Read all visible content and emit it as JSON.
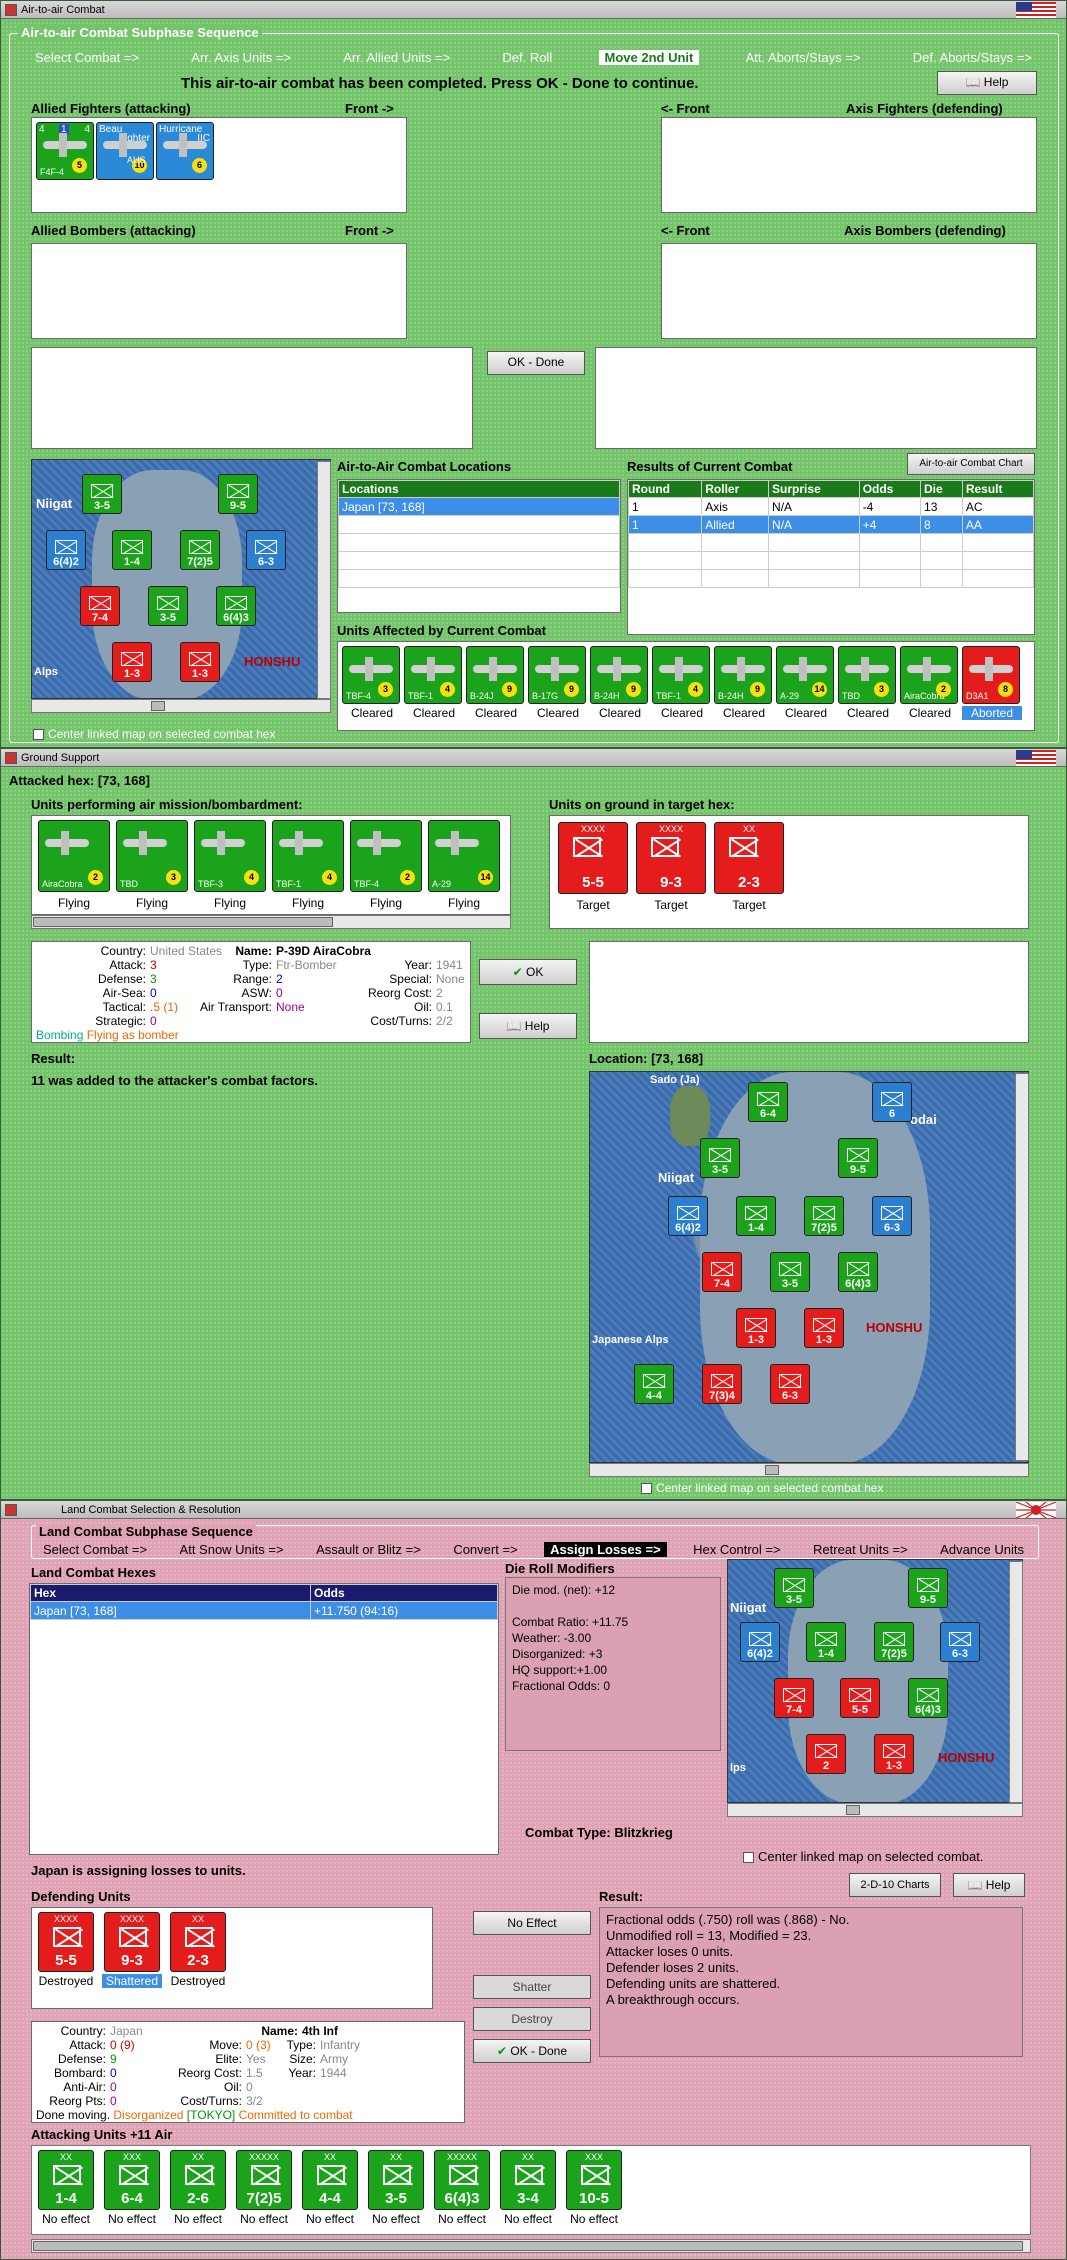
{
  "w1": {
    "title": "Air-to-air Combat",
    "group_title": "Air-to-air Combat Subphase Sequence",
    "steps": [
      "Select Combat =>",
      "Arr. Axis Units =>",
      "Arr. Allied Units =>",
      "Def. Roll",
      "Move 2nd Unit",
      "Att. Aborts/Stays =>",
      "Def. Aborts/Stays =>"
    ],
    "current_step": "Move 2nd Unit",
    "message": "This air-to-air combat has been completed.  Press OK - Done to continue.",
    "help": "Help",
    "allied_fighters": "Allied Fighters (attacking)",
    "front_right": "Front ->",
    "front_left": "<- Front",
    "axis_fighters": "Axis Fighters (defending)",
    "allied_bombers": "Allied Bombers (attacking)",
    "axis_bombers": "Axis Bombers (defending)",
    "ok_done": "OK - Done",
    "fighters": [
      {
        "type": "F4F-4",
        "a": "4",
        "b": "1",
        "c": "4",
        "val": "5"
      },
      {
        "type": "AUS",
        "a": "Beau",
        "b": "fighter",
        "c": "",
        "val": "10"
      },
      {
        "type": "",
        "a": "Hurricane",
        "b": "IIC",
        "c": "",
        "val": "6"
      }
    ],
    "locations_label": "Air-to-Air Combat Locations",
    "locations_header": "Locations",
    "locations": [
      "Japan [73, 168]"
    ],
    "results_label": "Results of Current Combat",
    "chart_btn": "Air-to-air Combat Chart",
    "results_headers": [
      "Round",
      "Roller",
      "Surprise",
      "Odds",
      "Die",
      "Result"
    ],
    "results": [
      [
        "1",
        "Axis",
        "N/A",
        "-4",
        "13",
        "AC"
      ],
      [
        "1",
        "Allied",
        "N/A",
        "+4",
        "8",
        "AA"
      ]
    ],
    "affected_label": "Units Affected by Current Combat",
    "affected": [
      {
        "type": "TBF-4",
        "val": "3",
        "status": "Cleared"
      },
      {
        "type": "TBF-1",
        "val": "4",
        "status": "Cleared"
      },
      {
        "type": "B-24J",
        "val": "9",
        "status": "Cleared"
      },
      {
        "type": "B-17G",
        "val": "9",
        "status": "Cleared"
      },
      {
        "type": "B-24H",
        "val": "9",
        "status": "Cleared"
      },
      {
        "type": "TBF-1",
        "val": "4",
        "status": "Cleared"
      },
      {
        "type": "B-24H",
        "val": "9",
        "status": "Cleared"
      },
      {
        "type": "A-29",
        "val": "14",
        "status": "Cleared"
      },
      {
        "type": "TBD",
        "val": "3",
        "status": "Cleared"
      },
      {
        "type": "AiraCobra",
        "val": "2",
        "status": "Cleared"
      },
      {
        "type": "D3A1",
        "val": "8",
        "status": "Aborted"
      }
    ],
    "map_labels": {
      "a": "Niigat",
      "b": "HONSHU",
      "c": "Alps"
    },
    "center_map": "Center linked map on selected combat hex"
  },
  "w2": {
    "title": "Ground Support",
    "attacked_hex": "Attacked hex:  [73, 168]",
    "units_air_label": "Units performing air mission/bombardment:",
    "units_ground_label": "Units on ground in target hex:",
    "air_units": [
      {
        "type": "AiraCobra",
        "name": "P-39D",
        "val": "2",
        "status": "Flying"
      },
      {
        "type": "TBD",
        "name": "",
        "val": "3",
        "status": "Flying"
      },
      {
        "type": "TBF-3",
        "name": "",
        "val": "4",
        "status": "Flying"
      },
      {
        "type": "TBF-1",
        "name": "",
        "val": "4",
        "status": "Flying"
      },
      {
        "type": "TBF-4",
        "name": "",
        "val": "2",
        "status": "Flying"
      },
      {
        "type": "A-29",
        "name": "Hudson",
        "val": "14",
        "status": "Flying"
      }
    ],
    "ground_units": [
      {
        "str": "5-5",
        "size": "XXXX",
        "status": "Target"
      },
      {
        "str": "9-3",
        "size": "XXXX",
        "status": "Target"
      },
      {
        "str": "2-3",
        "size": "XX",
        "status": "Target"
      }
    ],
    "info": {
      "country_l": "Country:",
      "country": "United States",
      "attack_l": "Attack:",
      "attack": "3",
      "defense_l": "Defense:",
      "defense": "3",
      "airsea_l": "Air-Sea:",
      "airsea": "0",
      "tactical_l": "Tactical:",
      "tactical": ".5 (1)",
      "strategic_l": "Strategic:",
      "strategic": "0",
      "mission": "Bombing",
      "mission2": "Flying as bomber",
      "name_l": "Name:",
      "name": "P-39D AiraCobra",
      "type_l": "Type:",
      "type": "Ftr-Bomber",
      "range_l": "Range:",
      "range": "2",
      "asw_l": "ASW:",
      "asw": "0",
      "transport_l": "Air Transport:",
      "transport": "None",
      "year_l": "Year:",
      "year": "1941",
      "special_l": "Special:",
      "special": "None",
      "reorg_l": "Reorg Cost:",
      "reorg": "2",
      "oil_l": "Oil:",
      "oil": "0.1",
      "cost_l": "Cost/Turns:",
      "cost": "2/2"
    },
    "ok": "OK",
    "help": "Help",
    "result_label": "Result:",
    "result_text": "11 was added to the attacker's combat factors.",
    "location_label": "Location:  [73, 168]",
    "map_labels": {
      "a": "Sado (Ja)",
      "b": "Niigat",
      "c": "HONSHU",
      "d": "Japanese Alps",
      "e": "odai"
    },
    "center_map": "Center linked map on selected combat hex"
  },
  "w3": {
    "title": "Land Combat Selection & Resolution",
    "group_title": "Land Combat Subphase Sequence",
    "steps": [
      "Select Combat =>",
      "Att Snow Units =>",
      "Assault or Blitz =>",
      "Convert =>",
      "Assign Losses =>",
      "Hex Control =>",
      "Retreat Units =>",
      "Advance Units"
    ],
    "current_step": "Assign Losses =>",
    "hexes_label": "Land Combat Hexes",
    "hex_headers": [
      "Hex",
      "Odds"
    ],
    "hexes": [
      [
        "Japan [73, 168]",
        "+11.750 (94:16)"
      ]
    ],
    "die_label": "Die Roll Modifiers",
    "die_lines": [
      "Die mod. (net): +12",
      "",
      "Combat Ratio: +11.75",
      "Weather: -3.00",
      "Disorganized: +3",
      "HQ support:+1.00",
      "Fractional Odds: 0"
    ],
    "combat_type": "Combat Type:  Blitzkrieg",
    "center_map": "Center linked map on selected combat.",
    "assigning": "Japan is assigning losses to units.",
    "defending_label": "Defending Units",
    "defenders": [
      {
        "str": "5-5",
        "size": "XXXX",
        "status": "Destroyed"
      },
      {
        "str": "9-3",
        "size": "XXXX",
        "status": "Shattered"
      },
      {
        "str": "2-3",
        "size": "XX",
        "status": "Destroyed"
      }
    ],
    "no_effect_btn": "No Effect",
    "shatter_btn": "Shatter",
    "destroy_btn": "Destroy",
    "ok_done": "OK - Done",
    "chart_btn": "2-D-10 Charts",
    "help": "Help",
    "result_label": "Result:",
    "result_lines": [
      "Fractional odds (.750) roll was (.868)  - No.",
      "Unmodified roll = 13, Modified = 23.",
      "Attacker loses 0 units.",
      "Defender loses 2 units.",
      "Defending units are shattered.",
      "A breakthrough occurs."
    ],
    "info": {
      "country_l": "Country:",
      "country": "Japan",
      "attack_l": "Attack:",
      "attack": "0 (9)",
      "defense_l": "Defense:",
      "defense": "9",
      "bombard_l": "Bombard:",
      "bombard": "0",
      "antiair_l": "Anti-Air:",
      "antiair": "0",
      "reorg_l": "Reorg Pts:",
      "reorg": "0",
      "move_l": "Move:",
      "move": "0 (3)",
      "elite_l": "Elite:",
      "elite": "Yes",
      "reorgc_l": "Reorg Cost:",
      "reorgc": "1.5",
      "oil_l": "Oil:",
      "oil": "0",
      "cost_l": "Cost/Turns:",
      "cost": "3/2",
      "name_l": "Name:",
      "name": "4th Inf",
      "type_l": "Type:",
      "type": "Infantry",
      "size_l": "Size:",
      "size": "Army",
      "year_l": "Year:",
      "year": "1944",
      "status1": "Done moving.",
      "status2": "Disorganized",
      "status3": "[TOKYO]",
      "status4": "Committed to combat"
    },
    "attacking_label": "Attacking Units +11 Air",
    "attackers": [
      {
        "str": "1-4",
        "size": "XX",
        "status": "No effect"
      },
      {
        "str": "6-4",
        "size": "XXX",
        "status": "No effect"
      },
      {
        "str": "2-6",
        "size": "XX",
        "status": "No effect"
      },
      {
        "str": "7(2)5",
        "size": "XXXXX",
        "status": "No effect"
      },
      {
        "str": "4-4",
        "size": "XX",
        "status": "No effect"
      },
      {
        "str": "3-5",
        "size": "XX",
        "status": "No effect"
      },
      {
        "str": "6(4)3",
        "size": "XXXXX",
        "status": "No effect"
      },
      {
        "str": "3-4",
        "size": "XX",
        "status": "No effect"
      },
      {
        "str": "10-5",
        "size": "XXX",
        "status": "No effect"
      }
    ],
    "map_labels": {
      "a": "Niigat",
      "b": "HONSHU",
      "c": "lps"
    }
  },
  "colors": {
    "green_bg": "#74c46c",
    "pink_bg": "#dfa3b5",
    "allied": "#1ba31b",
    "axis": "#e51c1c",
    "select": "#3c8ee6"
  }
}
